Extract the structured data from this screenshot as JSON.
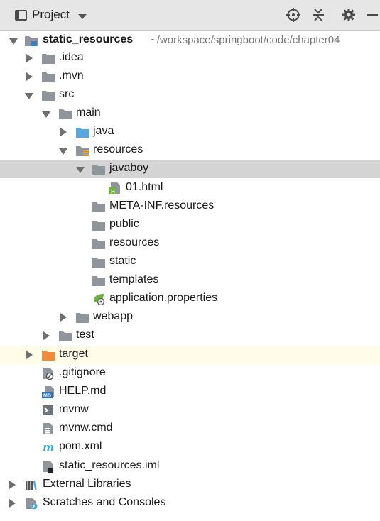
{
  "toolbar": {
    "title": "Project"
  },
  "tree": {
    "root": {
      "label": "static_resources",
      "path": "~/workspace/springboot/code/chapter04"
    },
    "idea": ".idea",
    "mvn": ".mvn",
    "src": "src",
    "main": "main",
    "java": "java",
    "resources": "resources",
    "javaboy": "javaboy",
    "file_01": "01.html",
    "meta_inf": "META-INF.resources",
    "public": "public",
    "resources2": "resources",
    "static": "static",
    "templates": "templates",
    "app_props": "application.properties",
    "webapp": "webapp",
    "test": "test",
    "target": "target",
    "gitignore": ".gitignore",
    "help": "HELP.md",
    "mvnw": "mvnw",
    "mvnw_cmd": "mvnw.cmd",
    "pom": "pom.xml",
    "iml": "static_resources.iml",
    "ext_libs": "External Libraries",
    "scratches": "Scratches and Consoles"
  },
  "icon_badges": {
    "html": "H",
    "md": "MD",
    "maven": "m"
  },
  "colors": {
    "folder": "#8f959b",
    "source_folder": "#56a8e0",
    "excluded_folder": "#f08a3c",
    "spring": "#6db33f",
    "maven": "#2ca7d6",
    "selection": "#d4d4d4",
    "highlight": "#fffde8"
  }
}
